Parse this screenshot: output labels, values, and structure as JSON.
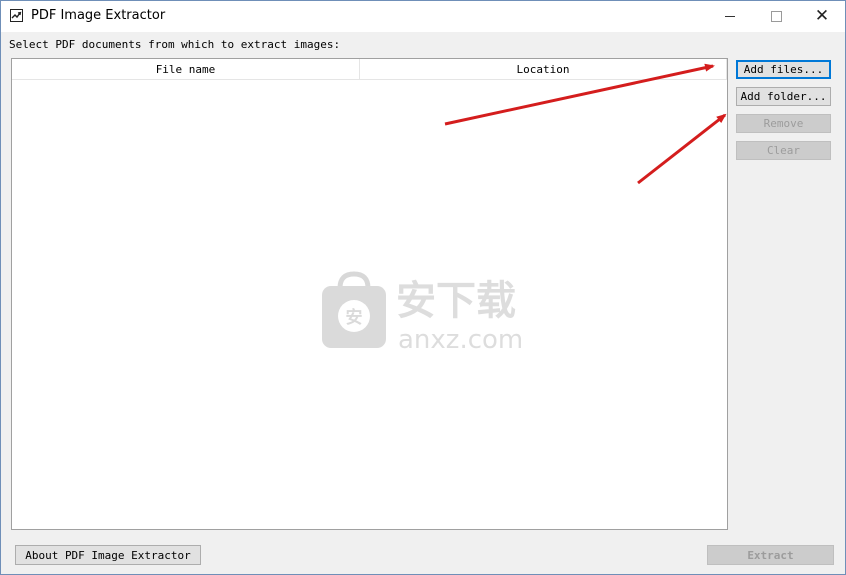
{
  "window": {
    "title": "PDF Image Extractor"
  },
  "main": {
    "prompt": "Select PDF documents from which to extract images:",
    "columns": [
      {
        "label": "File name"
      },
      {
        "label": "Location"
      }
    ],
    "rows": []
  },
  "buttons": {
    "add_files": "Add files...",
    "add_folder": "Add folder...",
    "remove": "Remove",
    "clear": "Clear",
    "about": "About PDF Image Extractor",
    "extract": "Extract"
  },
  "watermark": {
    "brand_cn": "安下载",
    "domain": "anxz.com"
  },
  "icons": {
    "app": "pdf-image-app-icon",
    "minimize": "minimize-icon",
    "maximize": "maximize-icon",
    "close": "close-icon"
  },
  "colors": {
    "focus_border": "#0078d7",
    "annotation_arrow": "#d41d1d",
    "disabled_text": "#9c9c9c"
  }
}
